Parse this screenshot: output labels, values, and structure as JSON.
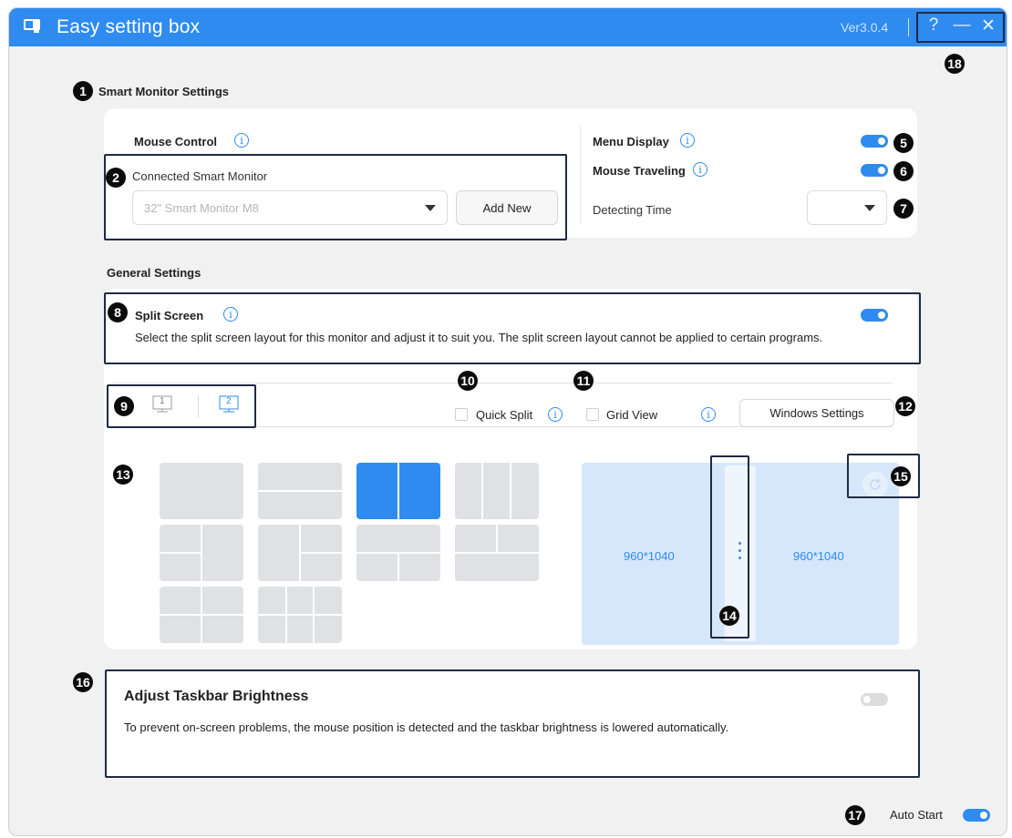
{
  "window": {
    "title": "Easy setting box",
    "version": "Ver3.0.4",
    "help_label": "?",
    "minimize_label": "—",
    "close_label": "✕",
    "accent_color": "#2f8bf0"
  },
  "markers": [
    "1",
    "2",
    "5",
    "6",
    "7",
    "8",
    "9",
    "10",
    "11",
    "12",
    "13",
    "14",
    "15",
    "16",
    "17",
    "18"
  ],
  "smart_monitor": {
    "heading": "Smart Monitor Settings",
    "mouse_control_label": "Mouse Control",
    "connected_label": "Connected Smart Monitor",
    "connected_value": "32\" Smart Monitor M8",
    "add_new_label": "Add New",
    "menu_display_label": "Menu Display",
    "menu_display_on": true,
    "mouse_traveling_label": "Mouse Traveling",
    "mouse_traveling_on": true,
    "detecting_time_label": "Detecting Time",
    "detecting_time_value": ""
  },
  "general": {
    "heading": "General Settings",
    "split_screen_label": "Split Screen",
    "split_screen_on": true,
    "split_screen_desc": "Select the split screen layout for this monitor and adjust it to suit you. The split screen layout cannot be applied to certain programs.",
    "monitor_1_label": "1",
    "monitor_2_label": "2",
    "selected_monitor": "2",
    "quick_split_label": "Quick Split",
    "grid_view_label": "Grid View",
    "windows_settings_label": "Windows Settings",
    "preview_left_res": "960*1040",
    "preview_right_res": "960*1040"
  },
  "taskbar": {
    "heading": "Adjust Taskbar Brightness",
    "desc": "To prevent on-screen problems, the mouse position is detected and the taskbar brightness is lowered automatically.",
    "on": false
  },
  "auto_start": {
    "label": "Auto Start",
    "on": true
  }
}
